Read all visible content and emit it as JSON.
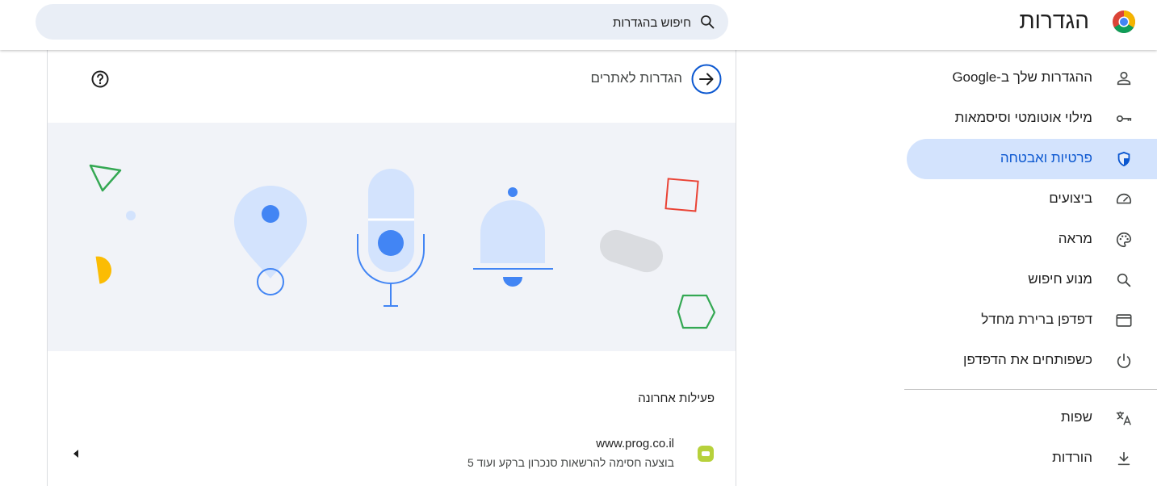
{
  "app": {
    "title": "הגדרות"
  },
  "search": {
    "placeholder": "חיפוש בהגדרות"
  },
  "sidebar": {
    "items": [
      {
        "label": "ההגדרות שלך ב-Google",
        "icon": "person-icon",
        "active": false
      },
      {
        "label": "מילוי אוטומטי וסיסמאות",
        "icon": "key-icon",
        "active": false
      },
      {
        "label": "פרטיות ואבטחה",
        "icon": "shield-icon",
        "active": true
      },
      {
        "label": "ביצועים",
        "icon": "speedometer-icon",
        "active": false
      },
      {
        "label": "מראה",
        "icon": "palette-icon",
        "active": false
      },
      {
        "label": "מנוע חיפוש",
        "icon": "search-icon",
        "active": false
      },
      {
        "label": "דפדפן ברירת מחדל",
        "icon": "browser-window-icon",
        "active": false
      },
      {
        "label": "כשפותחים את הדפדפן",
        "icon": "power-icon",
        "active": false
      }
    ],
    "items_after_divider": [
      {
        "label": "שפות",
        "icon": "translate-icon"
      },
      {
        "label": "הורדות",
        "icon": "download-icon"
      }
    ]
  },
  "card": {
    "title": "הגדרות לאתרים",
    "recent_title": "פעילות אחרונה",
    "recent": [
      {
        "site": "www.prog.co.il",
        "description": "בוצעה חסימה להרשאות סנכרון ברקע ועוד 5"
      }
    ]
  },
  "colors": {
    "accent": "#0b57d0",
    "active_bg": "#d3e3fd",
    "search_bg": "#e9eef6",
    "banner_bg": "#f1f3f8",
    "illustration_light": "#d3e3fd",
    "illustration_blue": "#4285f4"
  }
}
